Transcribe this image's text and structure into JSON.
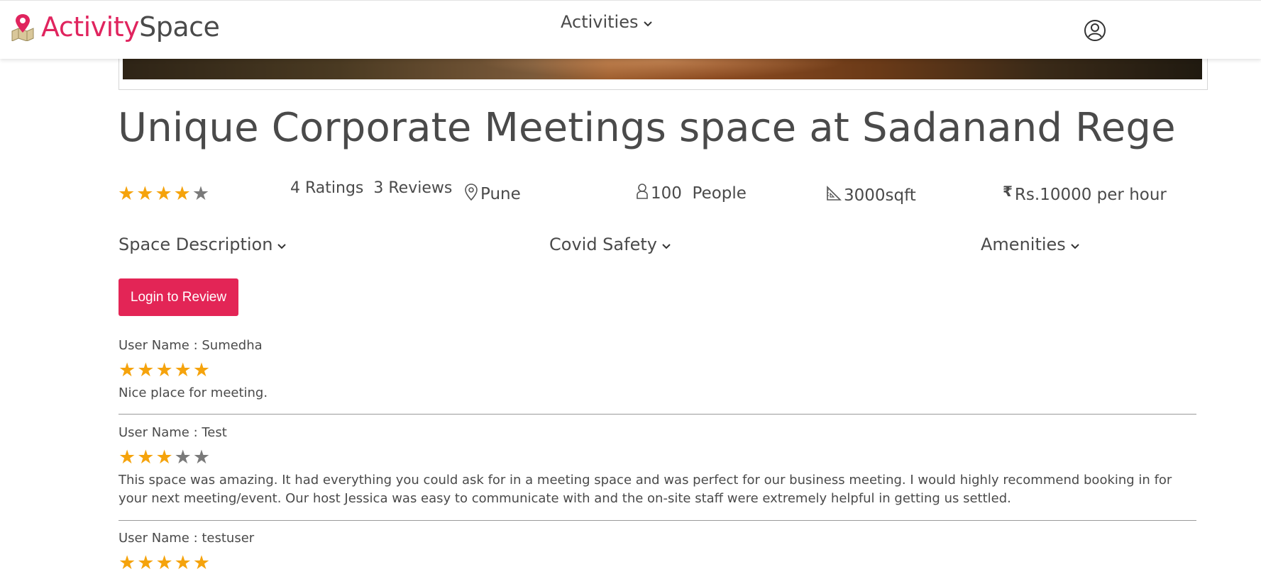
{
  "brand": {
    "part1": "Activity",
    "part2": "Space",
    "accent": "#e0245e"
  },
  "nav": {
    "activities_label": "Activities"
  },
  "title": "Unique Corporate Meetings space at Sadanand Rege",
  "stats": {
    "rating_stars": 4,
    "max_stars": 5,
    "ratings_text": "4 Ratings",
    "reviews_text": "3 Reviews",
    "location": "Pune",
    "capacity_number": "100",
    "capacity_unit": "People",
    "area": "3000sqft",
    "price": "Rs.10000 per hour"
  },
  "sections": {
    "description": "Space Description",
    "covid": "Covid Safety",
    "amenities": "Amenities"
  },
  "login_review_label": "Login to Review",
  "reviews": [
    {
      "user": "User Name : Sumedha",
      "stars": 5,
      "text": "Nice place for meeting."
    },
    {
      "user": "User Name : Test",
      "stars": 3,
      "text": "This space was amazing. It had everything you could ask for in a meeting space and was perfect for our business meeting. I would highly recommend booking in for your next meeting/event. Our host Jessica was easy to communicate with and the on-site staff were extremely helpful in getting us settled."
    },
    {
      "user": "User Name : testuser",
      "stars": 5,
      "text": ""
    }
  ],
  "colors": {
    "star_on": "#f5a30c",
    "star_off": "#7a7a7a",
    "button": "#e32556"
  },
  "icons": [
    "map-pin-logo-icon",
    "chevron-down-icon",
    "user-circle-icon",
    "location-pin-icon",
    "person-icon",
    "ruler-icon",
    "rupee-icon",
    "star-icon"
  ]
}
